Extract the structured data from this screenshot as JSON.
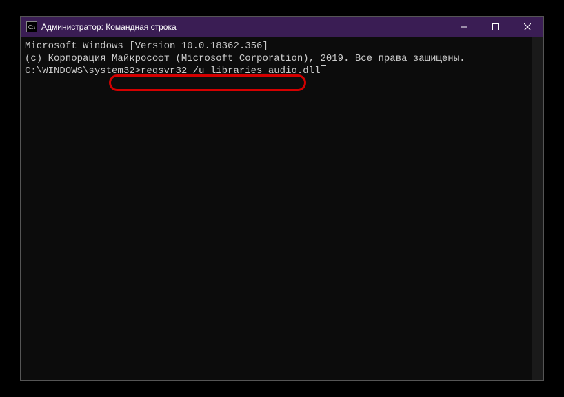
{
  "window": {
    "title": "Администратор: Командная строка"
  },
  "terminal": {
    "line1": "Microsoft Windows [Version 10.0.18362.356]",
    "line2": "(c) Корпорация Майкрософт (Microsoft Corporation), 2019. Все права защищены.",
    "blank": "",
    "prompt": "C:\\WINDOWS\\system32>",
    "command": "regsvr32 /u libraries_audio.dll"
  }
}
